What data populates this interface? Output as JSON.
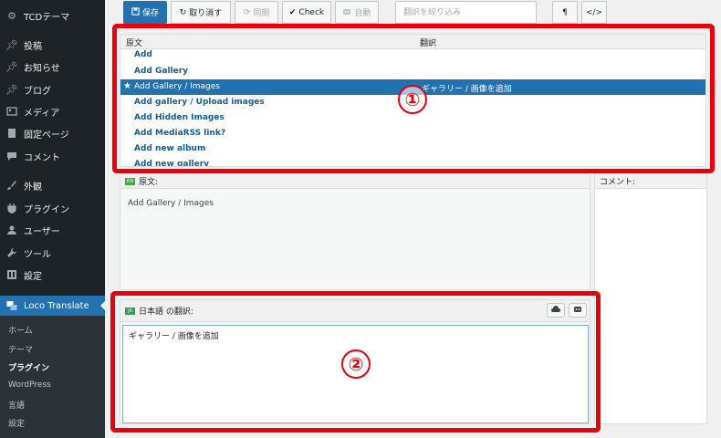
{
  "sidebar": {
    "site": {
      "label": "TCDテーマ",
      "icon": "gear-icon"
    },
    "items": [
      {
        "label": "投稿",
        "icon": "pin-icon"
      },
      {
        "label": "お知らせ",
        "icon": "pin-icon"
      },
      {
        "label": "ブログ",
        "icon": "pin-icon"
      },
      {
        "label": "メディア",
        "icon": "media-icon"
      },
      {
        "label": "固定ページ",
        "icon": "page-icon"
      },
      {
        "label": "コメント",
        "icon": "comment-icon"
      },
      {
        "label": "外観",
        "icon": "brush-icon"
      },
      {
        "label": "プラグイン",
        "icon": "plugin-icon"
      },
      {
        "label": "ユーザー",
        "icon": "user-icon"
      },
      {
        "label": "ツール",
        "icon": "wrench-icon"
      },
      {
        "label": "設定",
        "icon": "settings-icon"
      },
      {
        "label": "Loco Translate",
        "icon": "loco-icon"
      }
    ],
    "submenu": [
      "ホーム",
      "テーマ",
      "プラグイン",
      "WordPress",
      "言語",
      "設定"
    ]
  },
  "toolbar": {
    "save": "保存",
    "revert": "取り消す",
    "sync": "同期",
    "check": "Check",
    "auto": "自動",
    "filter_placeholder": "翻訳を絞り込み",
    "pilcrow": "¶",
    "code": "</>"
  },
  "list": {
    "col_source": "原文",
    "col_translation": "翻訳",
    "rows": [
      {
        "source": "Add",
        "translation": ""
      },
      {
        "source": "Add Gallery",
        "translation": ""
      },
      {
        "source": "Add Gallery / Images",
        "translation": "ギャラリー / 画像を追加"
      },
      {
        "source": "Add gallery / Upload images",
        "translation": ""
      },
      {
        "source": "Add Hidden Images",
        "translation": ""
      },
      {
        "source": "Add MediaRSS link?",
        "translation": ""
      },
      {
        "source": "Add new album",
        "translation": ""
      },
      {
        "source": "Add new gallery",
        "translation": ""
      }
    ]
  },
  "source_pane": {
    "flag": "EN",
    "label": "原文:",
    "text": "Add Gallery / Images"
  },
  "comment_pane": {
    "label": "コメント:"
  },
  "target_pane": {
    "flag": "JA",
    "label": "日本語 の翻訳:",
    "value": "ギャラリー / 画像を追加"
  },
  "annotations": {
    "one": "①",
    "two": "②"
  },
  "colors": {
    "sidebar": "#1d2327",
    "accent": "#2271b1",
    "highlight": "#e8000b"
  }
}
